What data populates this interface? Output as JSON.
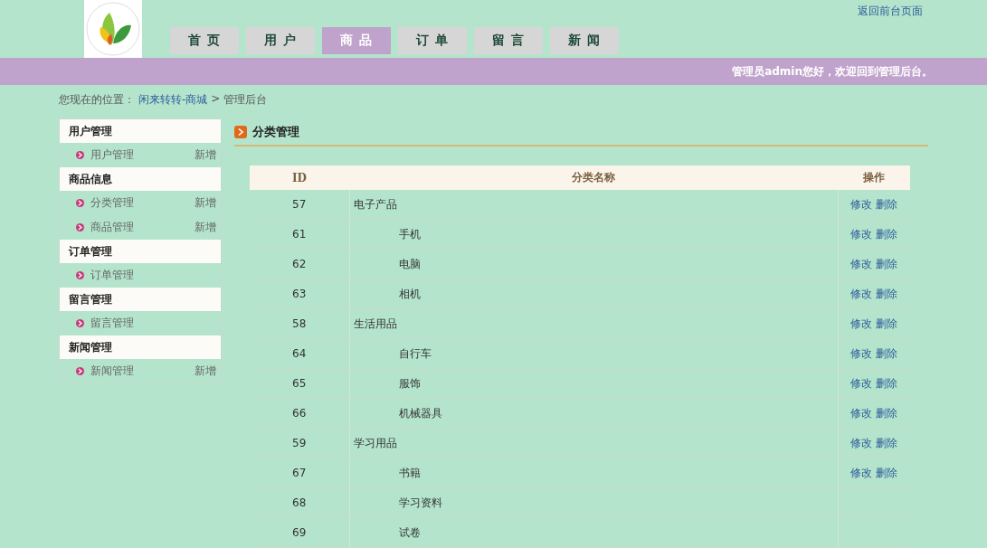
{
  "header": {
    "back_link": "返回前台页面",
    "nav": [
      {
        "label": "首 页",
        "selected": false
      },
      {
        "label": "用 户",
        "selected": false
      },
      {
        "label": "商 品",
        "selected": true
      },
      {
        "label": "订 单",
        "selected": false
      },
      {
        "label": "留 言",
        "selected": false
      },
      {
        "label": "新 闻",
        "selected": false
      }
    ],
    "welcome": "管理员admin您好，欢迎回到管理后台。"
  },
  "breadcrumb": {
    "label": "您现在的位置：",
    "link": "闲来转转-商城",
    "separator": ">",
    "current": "管理后台"
  },
  "sidebar": [
    {
      "title": "用户管理",
      "items": [
        {
          "label": "用户管理",
          "action": "新增"
        }
      ]
    },
    {
      "title": "商品信息",
      "items": [
        {
          "label": "分类管理",
          "action": "新增"
        },
        {
          "label": "商品管理",
          "action": "新增"
        }
      ]
    },
    {
      "title": "订单管理",
      "items": [
        {
          "label": "订单管理"
        }
      ]
    },
    {
      "title": "留言管理",
      "items": [
        {
          "label": "留言管理"
        }
      ]
    },
    {
      "title": "新闻管理",
      "items": [
        {
          "label": "新闻管理",
          "action": "新增"
        }
      ]
    }
  ],
  "panel_title": "分类管理",
  "table": {
    "columns": [
      "ID",
      "分类名称",
      "操作"
    ],
    "rows": [
      {
        "id": "57",
        "name": "电子产品",
        "actions": [
          "修改",
          "删除"
        ],
        "children": [
          {
            "id": "61",
            "name": "手机",
            "actions": [
              "修改",
              "删除"
            ]
          },
          {
            "id": "62",
            "name": "电脑",
            "actions": [
              "修改",
              "删除"
            ]
          },
          {
            "id": "63",
            "name": "相机",
            "actions": [
              "修改",
              "删除"
            ]
          }
        ]
      },
      {
        "id": "58",
        "name": "生活用品",
        "actions": [
          "修改",
          "删除"
        ],
        "children": [
          {
            "id": "64",
            "name": "自行车",
            "actions": [
              "修改",
              "删除"
            ]
          },
          {
            "id": "65",
            "name": "服饰",
            "actions": [
              "修改",
              "删除"
            ]
          },
          {
            "id": "66",
            "name": "机械器具",
            "actions": [
              "修改",
              "删除"
            ]
          }
        ]
      },
      {
        "id": "59",
        "name": "学习用品",
        "actions": [
          "修改",
          "删除"
        ],
        "children": [
          {
            "id": "67",
            "name": "书籍",
            "actions": [
              "修改",
              "删除"
            ]
          },
          {
            "id": "68",
            "name": "学习资料"
          },
          {
            "id": "69",
            "name": "试卷"
          }
        ]
      }
    ]
  }
}
